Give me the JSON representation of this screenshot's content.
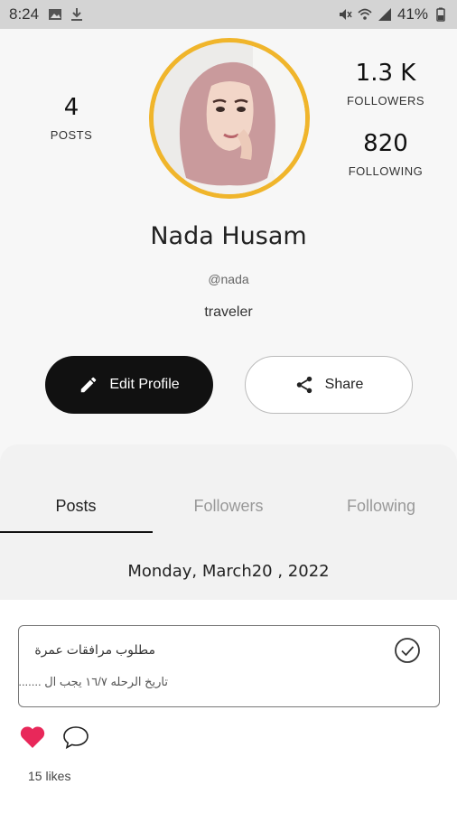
{
  "status_bar": {
    "time": "8:24",
    "battery": "41%"
  },
  "profile": {
    "posts_count": "4",
    "posts_label": "POSTS",
    "followers_count": "1.3 K",
    "followers_label": "FOLLOWERS",
    "following_count": "820",
    "following_label": "FOLLOWING",
    "name": "Nada Husam",
    "handle": "@nada",
    "bio": "traveler",
    "avatar_border_color": "#f0b52b"
  },
  "buttons": {
    "edit_label": "Edit Profile",
    "share_label": "Share"
  },
  "tabs": [
    {
      "label": "Posts",
      "active": true
    },
    {
      "label": "Followers",
      "active": false
    },
    {
      "label": "Following",
      "active": false
    }
  ],
  "feed": {
    "date": "Monday, March20 , 2022",
    "post": {
      "title": "مطلوب مرافقات عمرة",
      "body": "تاريخ الرحله ١٦/٧ يجب ال ......."
    },
    "likes_text": "15 likes",
    "heart_color": "#e8285a"
  },
  "icons": [
    "image-icon",
    "download-icon",
    "mute-icon",
    "wifi-icon",
    "signal-icon",
    "battery-icon",
    "pencil-icon",
    "share-icon",
    "check-circle-icon",
    "heart-icon",
    "comment-icon"
  ]
}
